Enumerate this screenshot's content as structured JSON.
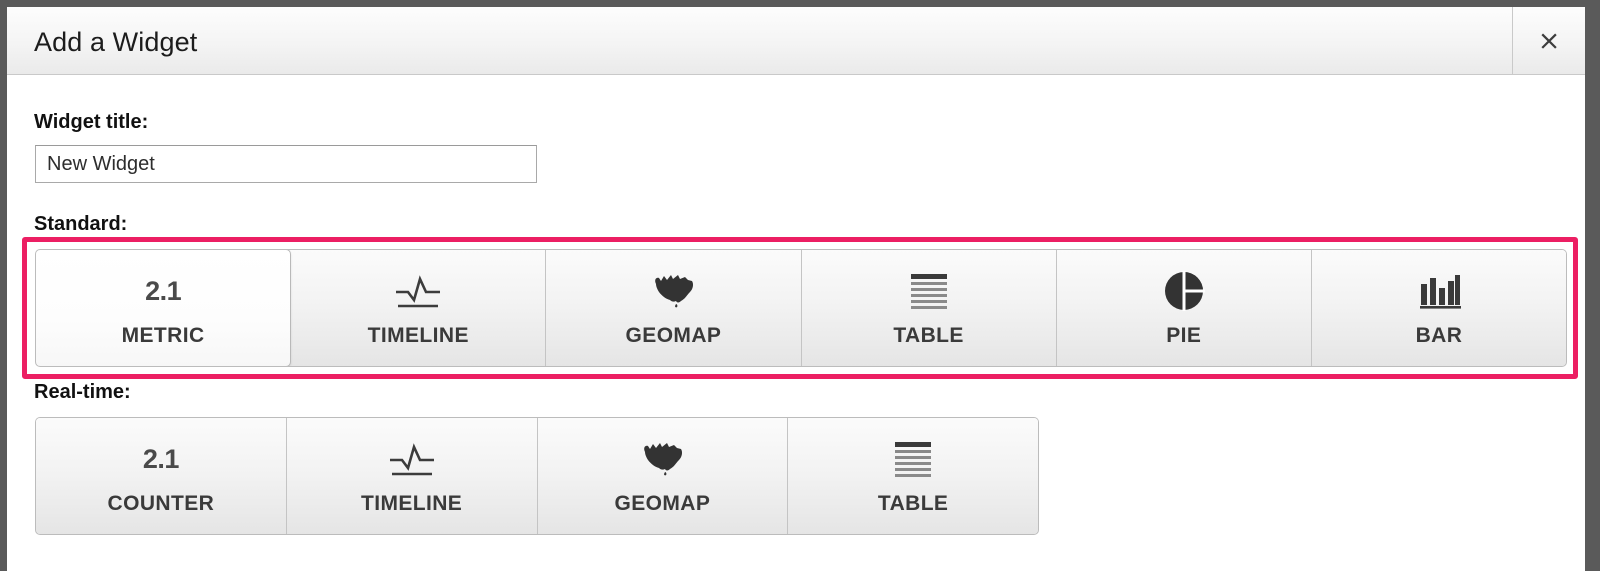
{
  "dialog": {
    "title": "Add a Widget",
    "close_label": "×",
    "close_icon": "close-icon"
  },
  "form": {
    "widget_title_label": "Widget title:",
    "widget_title_value": "New Widget",
    "widget_title_placeholder": "New Widget"
  },
  "sections": {
    "standard": {
      "label": "Standard:",
      "highlight_color": "#ec1f63",
      "selected": "METRIC",
      "options": [
        {
          "label": "METRIC",
          "icon": "numeric-2-1-icon",
          "icon_text": "2.1",
          "selected": true
        },
        {
          "label": "TIMELINE",
          "icon": "timeline-pulse-icon",
          "icon_text": "",
          "selected": false
        },
        {
          "label": "GEOMAP",
          "icon": "geomap-australia-icon",
          "icon_text": "",
          "selected": false
        },
        {
          "label": "TABLE",
          "icon": "table-rows-icon",
          "icon_text": "",
          "selected": false
        },
        {
          "label": "PIE",
          "icon": "pie-chart-icon",
          "icon_text": "",
          "selected": false
        },
        {
          "label": "BAR",
          "icon": "bar-chart-icon",
          "icon_text": "",
          "selected": false
        }
      ]
    },
    "realtime": {
      "label": "Real-time:",
      "selected": "",
      "options": [
        {
          "label": "COUNTER",
          "icon": "numeric-2-1-icon",
          "icon_text": "2.1",
          "selected": false
        },
        {
          "label": "TIMELINE",
          "icon": "timeline-pulse-icon",
          "icon_text": "",
          "selected": false
        },
        {
          "label": "GEOMAP",
          "icon": "geomap-australia-icon",
          "icon_text": "",
          "selected": false
        },
        {
          "label": "TABLE",
          "icon": "table-rows-icon",
          "icon_text": "",
          "selected": false
        }
      ]
    }
  }
}
